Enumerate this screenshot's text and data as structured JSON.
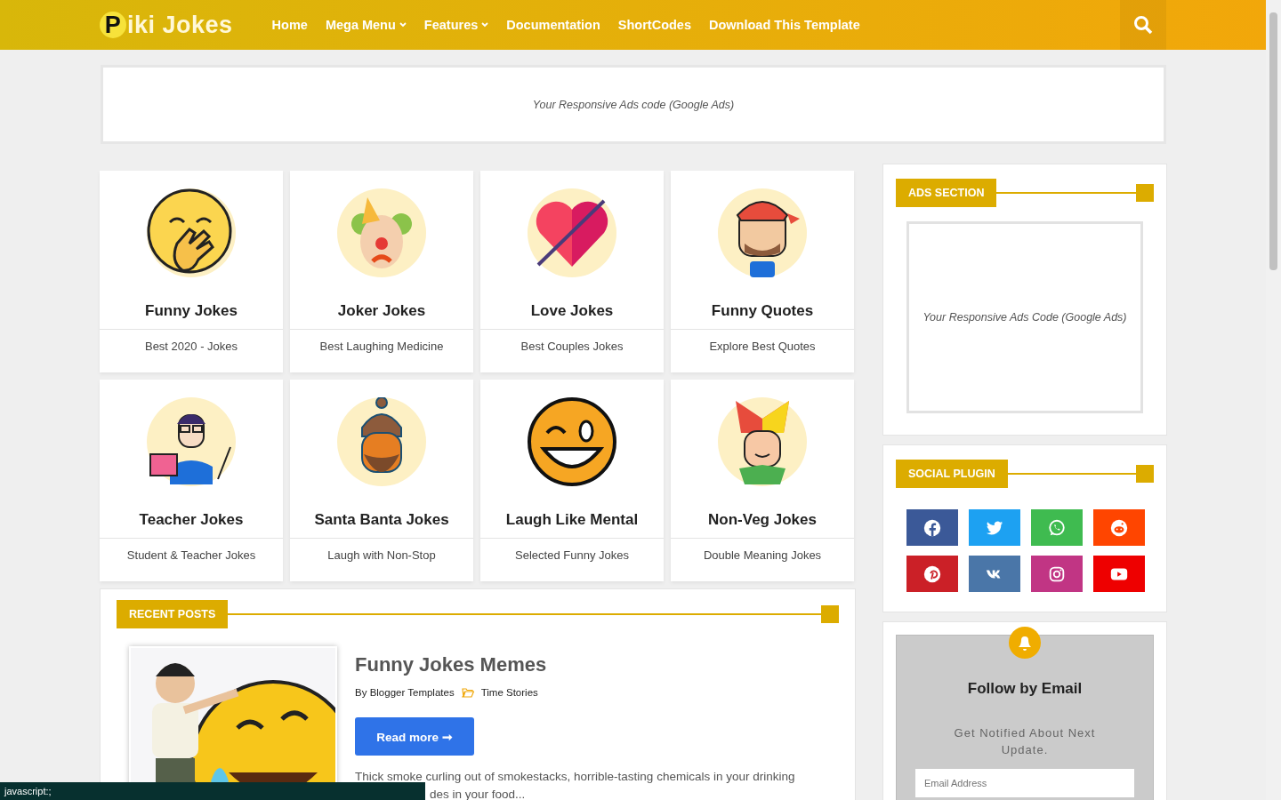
{
  "header": {
    "logo": "Piki Jokes",
    "nav": [
      {
        "label": "Home",
        "dropdown": false
      },
      {
        "label": "Mega Menu",
        "dropdown": true
      },
      {
        "label": "Features",
        "dropdown": true
      },
      {
        "label": "Documentation",
        "dropdown": false
      },
      {
        "label": "ShortCodes",
        "dropdown": false
      },
      {
        "label": "Download This Template",
        "dropdown": false
      }
    ]
  },
  "top_ad": {
    "text": "Your Responsive Ads code (Google Ads)"
  },
  "categories": [
    {
      "title": "Funny Jokes",
      "subtitle": "Best 2020 - Jokes"
    },
    {
      "title": "Joker Jokes",
      "subtitle": "Best Laughing Medicine"
    },
    {
      "title": "Love Jokes",
      "subtitle": "Best Couples Jokes"
    },
    {
      "title": "Funny Quotes",
      "subtitle": "Explore Best Quotes"
    },
    {
      "title": "Teacher Jokes",
      "subtitle": "Student & Teacher Jokes"
    },
    {
      "title": "Santa Banta Jokes",
      "subtitle": "Laugh with Non-Stop"
    },
    {
      "title": "Laugh Like Mental",
      "subtitle": "Selected Funny Jokes"
    },
    {
      "title": "Non-Veg Jokes",
      "subtitle": "Double Meaning Jokes"
    }
  ],
  "recent_posts": {
    "heading": "RECENT POSTS",
    "posts": [
      {
        "title": "Funny Jokes Memes",
        "author_prefix": "By",
        "author": "Blogger Templates",
        "category": "Time Stories",
        "button": "Read more ➞",
        "excerpt_lines": [
          "Thick smoke curling out of smokestacks, horrible-tasting chemicals in your drinking",
          "des in your food..."
        ]
      }
    ]
  },
  "sidebar": {
    "ads": {
      "heading": "ADS SECTION",
      "text": "Your Responsive Ads Code (Google Ads)"
    },
    "social": {
      "heading": "SOCIAL PLUGIN",
      "buttons": [
        {
          "kind": "facebook",
          "color": "#3b5998"
        },
        {
          "kind": "twitter",
          "color": "#1da1f2"
        },
        {
          "kind": "whatsapp",
          "color": "#3fbb50"
        },
        {
          "kind": "reddit",
          "color": "#ff4500"
        },
        {
          "kind": "pinterest",
          "color": "#cb2027"
        },
        {
          "kind": "vk",
          "color": "#4a76a8"
        },
        {
          "kind": "instagram",
          "color": "#c13584"
        },
        {
          "kind": "youtube",
          "color": "#ee0000"
        }
      ]
    },
    "follow": {
      "title": "Follow by Email",
      "text": "Get Notified About Next Update.",
      "placeholder": "Email Address"
    }
  },
  "status_bar": {
    "text": "javascript:;"
  }
}
